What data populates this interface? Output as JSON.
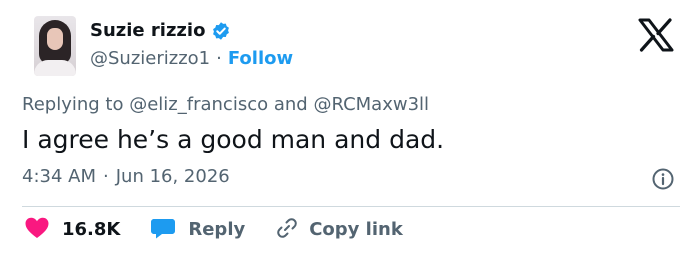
{
  "author": {
    "name": "Suzie rizzio",
    "handle": "@Suzierizzo1",
    "follow_label": "Follow",
    "separator": "·",
    "verified": true
  },
  "reply_context": {
    "prefix": "Replying to",
    "mention_1": "@eliz_francisco",
    "conjunction": "and",
    "mention_2": "@RCMaxw3ll"
  },
  "tweet": {
    "text": "I agree he’s a good man and dad.",
    "time": "4:34 AM",
    "separator": "·",
    "date": "Jun 16, 2026"
  },
  "actions": {
    "like_count": "16.8K",
    "reply_label": "Reply",
    "copy_link_label": "Copy link"
  },
  "colors": {
    "accent": "#1d9bf0",
    "like": "#f91880",
    "secondary_text": "#536471",
    "primary_text": "#0f1419"
  },
  "icons": {
    "verified": "verified-badge-icon",
    "logo": "x-logo-icon",
    "info": "info-icon",
    "like": "heart-icon",
    "reply": "speech-bubble-icon",
    "copy_link": "link-icon"
  }
}
